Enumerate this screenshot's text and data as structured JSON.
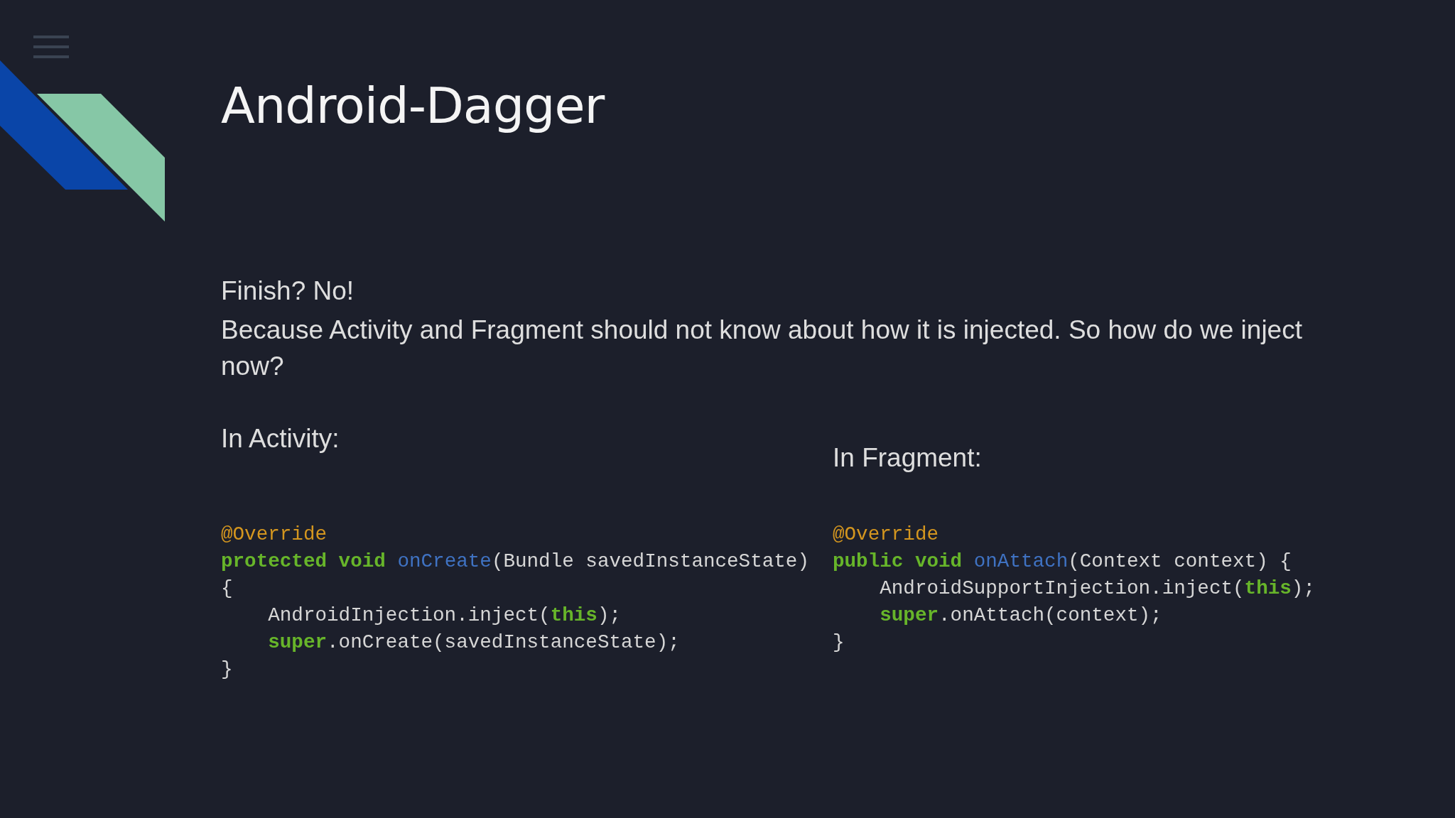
{
  "title": "Android-Dagger",
  "paragraphs": [
    "Finish? No!",
    "Because Activity and Fragment should not know about how it is injected. So how do we inject now?"
  ],
  "columns": [
    {
      "heading": "In Activity:",
      "code": [
        [
          {
            "kind": "annotation",
            "text": "@Override"
          }
        ],
        [
          {
            "kind": "keyword",
            "text": "protected void "
          },
          {
            "kind": "method",
            "text": "onCreate"
          },
          {
            "kind": "plain",
            "text": "(Bundle savedInstanceState)"
          }
        ],
        [
          {
            "kind": "plain",
            "text": "{"
          }
        ],
        [
          {
            "kind": "plain",
            "text": "    AndroidInjection.inject("
          },
          {
            "kind": "keyword",
            "text": "this"
          },
          {
            "kind": "plain",
            "text": ");"
          }
        ],
        [
          {
            "kind": "keyword",
            "text": "    super"
          },
          {
            "kind": "plain",
            "text": ".onCreate(savedInstanceState);"
          }
        ],
        [
          {
            "kind": "plain",
            "text": "}"
          }
        ]
      ]
    },
    {
      "heading": "In Fragment:",
      "code": [
        [
          {
            "kind": "annotation",
            "text": "@Override"
          }
        ],
        [
          {
            "kind": "keyword",
            "text": "public void "
          },
          {
            "kind": "method",
            "text": "onAttach"
          },
          {
            "kind": "plain",
            "text": "(Context context) {"
          }
        ],
        [
          {
            "kind": "plain",
            "text": "    AndroidSupportInjection.inject("
          },
          {
            "kind": "keyword",
            "text": "this"
          },
          {
            "kind": "plain",
            "text": ");"
          }
        ],
        [
          {
            "kind": "keyword",
            "text": "    super"
          },
          {
            "kind": "plain",
            "text": ".onAttach(context);"
          }
        ],
        [
          {
            "kind": "plain",
            "text": "}"
          }
        ]
      ]
    }
  ]
}
